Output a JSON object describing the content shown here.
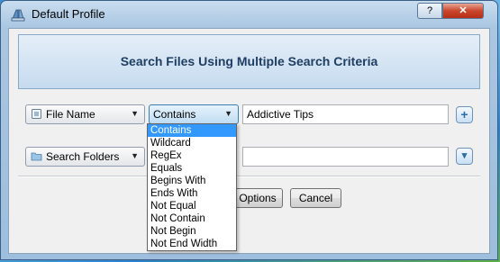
{
  "window": {
    "title": "Default Profile",
    "help_label": "?",
    "close_label": "✕"
  },
  "banner": {
    "text": "Search Files Using Multiple Search Criteria"
  },
  "row1": {
    "field_combo": "File Name",
    "operator_combo": "Contains",
    "value": "Addictive Tips",
    "add_label": "+"
  },
  "row2": {
    "location_combo": "Search Folders",
    "path_value": "",
    "dropdown_label": "▾"
  },
  "buttons": {
    "options": "Options",
    "cancel": "Cancel"
  },
  "operator_options": [
    "Contains",
    "Wildcard",
    "RegEx",
    "Equals",
    "Begins With",
    "Ends With",
    "Not Equal",
    "Not Contain",
    "Not Begin",
    "Not End Width"
  ],
  "selected_option": "Contains",
  "icons": {
    "app": "binoculars-icon",
    "file": "file-icon",
    "folder": "folder-icon"
  }
}
